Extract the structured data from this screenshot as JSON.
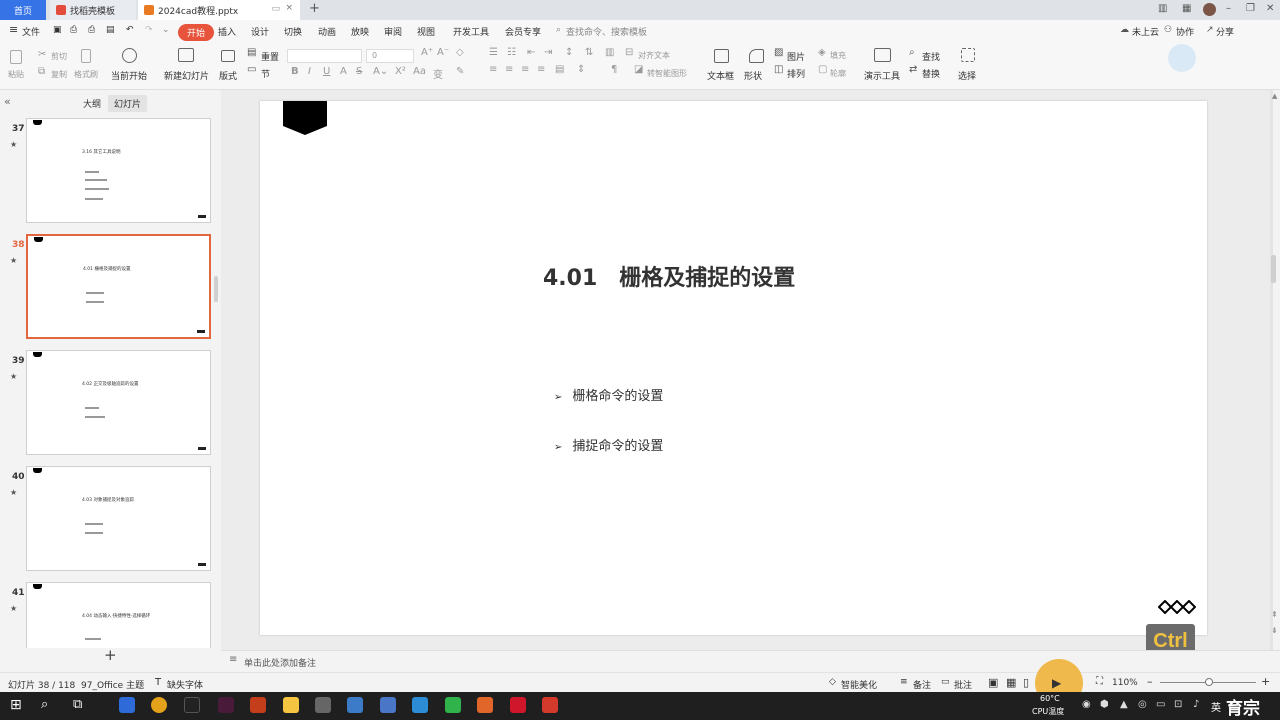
{
  "tabs": {
    "home": "首页",
    "template": "找稻壳模板",
    "document": "2024cad教程.pptx",
    "new_tab": "+"
  },
  "menu": {
    "file": "文件",
    "items": [
      "开始",
      "插入",
      "设计",
      "切换",
      "动画",
      "放映",
      "审阅",
      "视图",
      "开发工具",
      "会员专享"
    ],
    "search_placeholder": "查找命令、搜索模板",
    "upload": "未上云",
    "collab": "协作",
    "share": "分享"
  },
  "ribbon": {
    "paste": "粘贴",
    "cut": "剪切",
    "copy": "复制",
    "format_painter": "格式刷",
    "play_from_current": "当前开始",
    "new_slide": "新建幻灯片",
    "layout": "版式",
    "reset": "重置",
    "section": "节",
    "font_size": "0",
    "align_text": "对齐文本",
    "smart_shape": "转智能图形",
    "textbox": "文本框",
    "shape": "形状",
    "picture": "图片",
    "arrange": "排列",
    "fill": "填充",
    "outline": "轮廓",
    "presenter_tools": "演示工具",
    "find": "查找",
    "replace": "替换",
    "select": "选择"
  },
  "panel": {
    "outline_tab": "大纲",
    "slides_tab": "幻灯片",
    "add_slide": "+"
  },
  "thumbnails": [
    {
      "num": "37",
      "title": "3.16 其它工具说明",
      "lines": 4
    },
    {
      "num": "38",
      "title": "4.01 栅格及捕捉的设置",
      "lines": 2
    },
    {
      "num": "39",
      "title": "4.02 正交及极轴追踪的设置",
      "lines": 2
    },
    {
      "num": "40",
      "title": "4.03 对象捕捉及对象追踪",
      "lines": 2
    },
    {
      "num": "41",
      "title": "4.04 动态输入·快捷特性·选择循环",
      "lines": 1
    }
  ],
  "slide": {
    "title_num": "4.01",
    "title_text": "栅格及捕捉的设置",
    "bullets": [
      "栅格命令的设置",
      "捕捉命令的设置"
    ]
  },
  "notes_placeholder": "单击此处添加备注",
  "status": {
    "slide_counter": "幻灯片 38 / 118",
    "theme": "97_Office 主题",
    "missing_font": "缺失字体",
    "smart_beautify": "智能美化",
    "notes": "备注",
    "comments": "批注",
    "zoom": "110%"
  },
  "overlay": {
    "key_hint": "Ctrl"
  },
  "taskbar": {
    "cpu_temp": "60°C",
    "cpu_label": "CPU温度",
    "ime": "英",
    "watermark": "育宗"
  }
}
